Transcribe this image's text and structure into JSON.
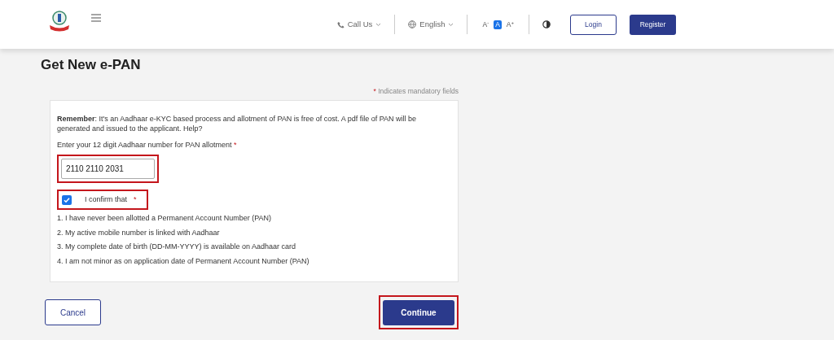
{
  "header": {
    "call_us": "Call Us",
    "language": "English",
    "font_sizes": [
      {
        "label": "A",
        "sup": "-",
        "selected": false
      },
      {
        "label": "A",
        "selected": true
      },
      {
        "label": "A",
        "sup": "+",
        "selected": false
      }
    ],
    "login": "Login",
    "register": "Register"
  },
  "page_title": "Get New e-PAN",
  "mandatory_mark": "*",
  "mandatory_note": "Indicates mandatory fields",
  "remember": "**Remember**: It's an Aadhaar e-KYC based process and allotment of PAN is free of cost. A pdf file of PAN will be generated and issued to the applicant. Help?",
  "aadhaar_field": {
    "label": "Enter your 12 digit Aadhaar number for PAN allotment",
    "required_mark": "*",
    "value": "2110 2110 2031",
    "highlighted": true
  },
  "confirm": {
    "label": "I confirm that",
    "required_mark": "*",
    "checked": true,
    "highlighted": true
  },
  "conditions": [
    "1. I have never been allotted a Permanent Account Number (PAN)",
    "2. My active mobile number is linked with Aadhaar",
    "3. My complete date of birth (DD-MM-YYYY) is available on Aadhaar card",
    "4. I am not minor as on application date of Permanent Account Number (PAN)"
  ],
  "buttons": [
    {
      "label": "Cancel",
      "kind": "outline",
      "highlighted": false
    },
    {
      "label": "Continue",
      "kind": "primary",
      "highlighted": true
    }
  ]
}
